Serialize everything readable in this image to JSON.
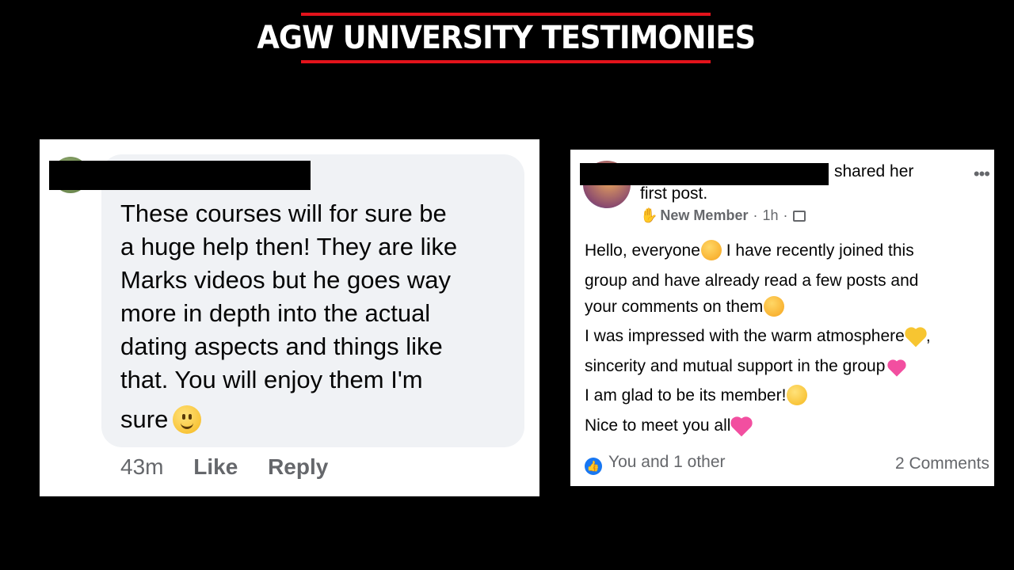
{
  "title": "AGW UNIVERSITY TESTIMONIES",
  "colors": {
    "accent": "#e3131b",
    "background": "#000000",
    "facebook_blue": "#1877f2"
  },
  "left_comment": {
    "text_lines": [
      "These courses will for sure be",
      "a huge help then! They are like",
      "Marks videos but he goes way",
      "more in depth into the actual",
      "dating aspects and things like",
      "that. You will enjoy them I'm",
      "sure"
    ],
    "emoji": "slightly-smiling-face-icon",
    "time": "43m",
    "like_label": "Like",
    "reply_label": "Reply"
  },
  "right_post": {
    "header_suffix": "shared her",
    "header_line2": "first post.",
    "badge": "New Member",
    "time": "1h",
    "body_lines": [
      "Hello, everyone",
      " I have recently joined this",
      "group and have already read a few posts and",
      "your comments on them",
      " I was impressed with the warm atmosphere",
      ",",
      "sincerity and mutual support in the group",
      "I am glad to be its member!",
      "Nice to meet you all"
    ],
    "reactions": "You and 1 other",
    "comments": "2 Comments"
  }
}
